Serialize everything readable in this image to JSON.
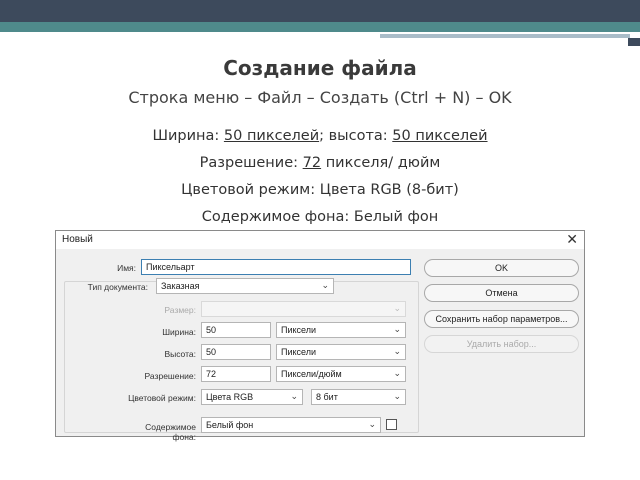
{
  "slide": {
    "title": "Создание файла",
    "subtitle": "Строка меню – Файл – Создать (Ctrl + N) – OK",
    "width_prefix": "Ширина: ",
    "width_value": "50 пикселей",
    "height_prefix": "; высота: ",
    "height_value": "50 пикселей",
    "resolution_prefix": "Разрешение: ",
    "resolution_value": "72",
    "resolution_suffix": " пикселя/ дюйм",
    "color_mode": "Цветовой режим: Цвета RGB (8-бит)",
    "background": "Содержимое фона: Белый фон"
  },
  "dialog": {
    "title": "Новый",
    "name_label": "Имя:",
    "name_value": "Пиксельарт",
    "doc_type_label": "Тип документа:",
    "doc_type_value": "Заказная",
    "size_label": "Размер:",
    "size_value": "",
    "width_label": "Ширина:",
    "width_value": "50",
    "width_unit": "Пиксели",
    "height_label": "Высота:",
    "height_value": "50",
    "height_unit": "Пиксели",
    "resolution_label": "Разрешение:",
    "resolution_value": "72",
    "resolution_unit": "Пиксели/дюйм",
    "color_mode_label": "Цветовой режим:",
    "color_mode_value": "Цвета RGB",
    "bit_depth_value": "8 бит",
    "background_label": "Содержимое фона:",
    "background_value": "Белый фон",
    "ok_label": "OK",
    "cancel_label": "Отмена",
    "save_preset_label": "Сохранить набор параметров...",
    "delete_preset_label": "Удалить набор..."
  }
}
